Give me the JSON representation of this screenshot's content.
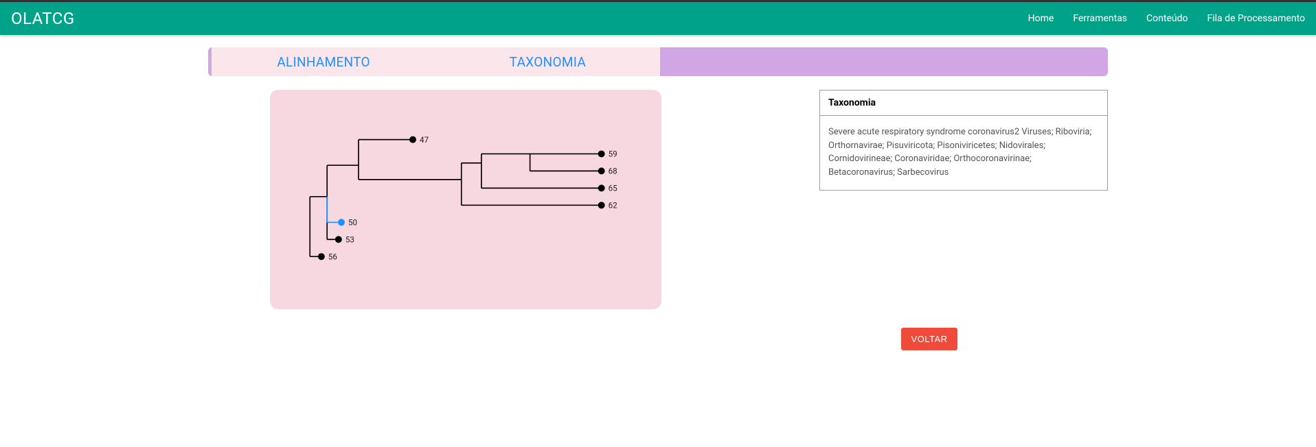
{
  "brand": "OLATCG",
  "nav": {
    "home": "Home",
    "ferramentas": "Ferramentas",
    "conteudo": "Conteúdo",
    "fila": "Fila de Processamento"
  },
  "tabs": {
    "alinhamento": "ALINHAMENTO",
    "taxonomia": "TAXONOMIA"
  },
  "tree": {
    "selected_node": 50,
    "nodes": {
      "n47": "47",
      "n59": "59",
      "n68": "68",
      "n65": "65",
      "n62": "62",
      "n50": "50",
      "n53": "53",
      "n56": "56"
    }
  },
  "info": {
    "title": "Taxonomia",
    "body": "Severe acute respiratory syndrome coronavirus2 Viruses; Riboviria; Orthornavirae; Pisuviricota; Pisoniviricetes; Nidovirales; Cornidovirineae; Coronaviridae; Orthocoronavirinae; Betacoronavirus; Sarbecovirus"
  },
  "buttons": {
    "voltar": "VOLTAR"
  }
}
